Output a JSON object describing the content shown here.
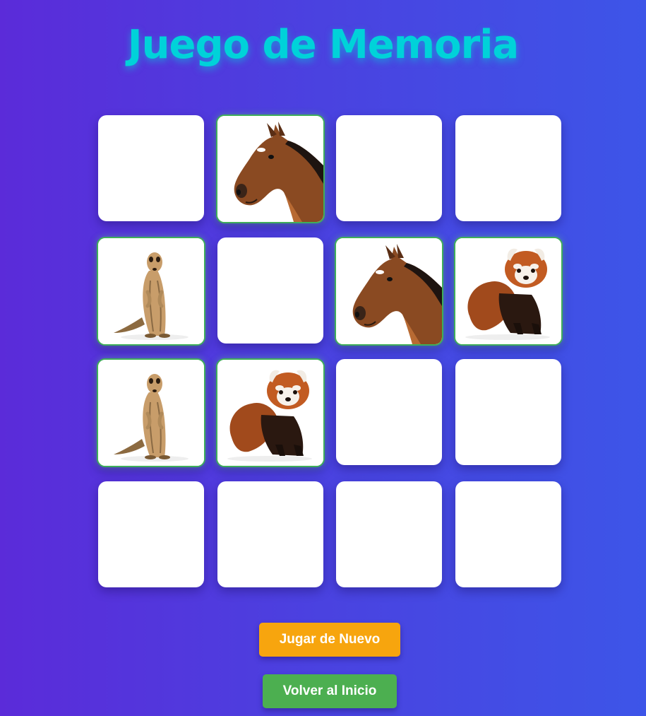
{
  "title": "Juego de Memoria",
  "board": {
    "columns": 4,
    "rows": 4,
    "cards": [
      {
        "state": "hidden",
        "animal": null
      },
      {
        "state": "matched",
        "animal": "horse"
      },
      {
        "state": "hidden",
        "animal": null
      },
      {
        "state": "hidden",
        "animal": null
      },
      {
        "state": "matched",
        "animal": "meerkat"
      },
      {
        "state": "hidden",
        "animal": null
      },
      {
        "state": "matched",
        "animal": "horse"
      },
      {
        "state": "matched",
        "animal": "red-panda"
      },
      {
        "state": "matched",
        "animal": "meerkat"
      },
      {
        "state": "matched",
        "animal": "red-panda"
      },
      {
        "state": "hidden",
        "animal": null
      },
      {
        "state": "hidden",
        "animal": null
      },
      {
        "state": "hidden",
        "animal": null
      },
      {
        "state": "hidden",
        "animal": null
      },
      {
        "state": "hidden",
        "animal": null
      },
      {
        "state": "hidden",
        "animal": null
      }
    ]
  },
  "buttons": {
    "play_again": "Jugar de Nuevo",
    "back_home": "Volver al Inicio"
  },
  "colors": {
    "title": "#00d2d9",
    "matched_border": "#3fae5a",
    "play_again_bg": "#f7a50e",
    "back_home_bg": "#4caf50",
    "background_start": "#5b2bd9",
    "background_end": "#3d55e8"
  }
}
